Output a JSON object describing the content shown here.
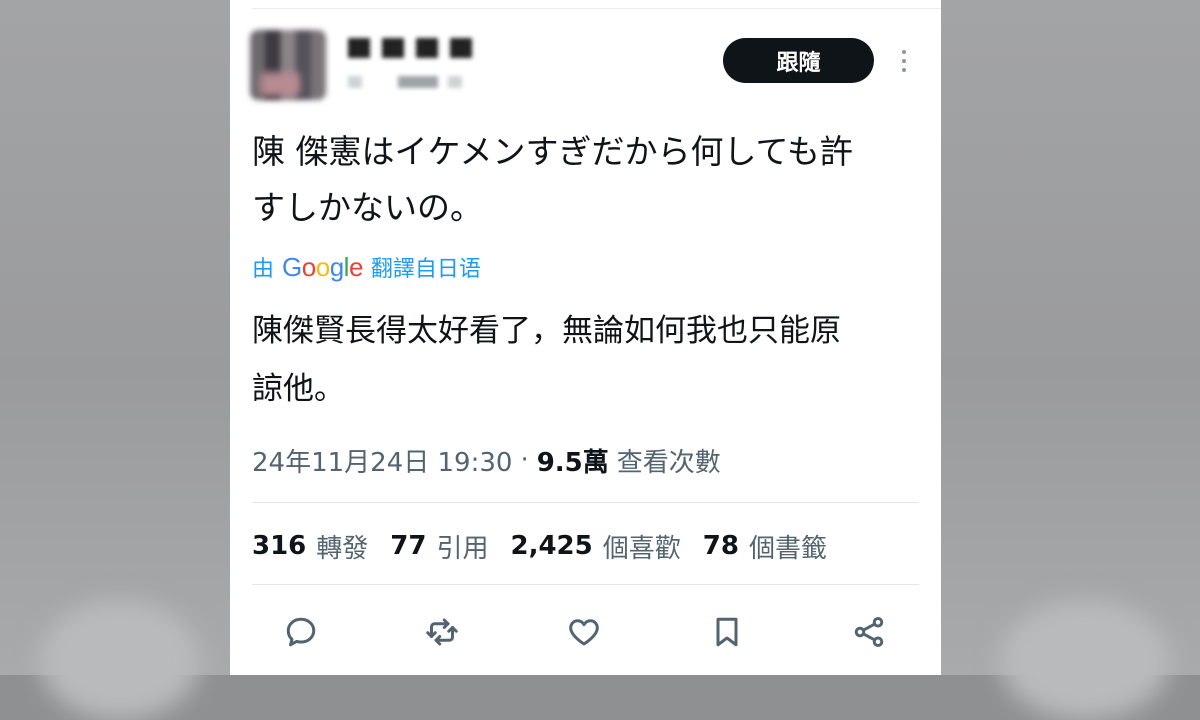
{
  "header": {
    "follow_label": "跟隨",
    "more_icon": "more-vertical-icon"
  },
  "tweet": {
    "text_line1": "陳 傑憲はイケメンすぎだから何しても許",
    "text_line2": "すしかないの。",
    "translated_by_prefix": "由",
    "translated_by_brand": "Google",
    "translated_by_suffix": "翻譯自日语",
    "translation_line1": "陳傑賢長得太好看了，無論如何我也只能原",
    "translation_line2": "諒他。",
    "timestamp": "24年11月24日 19:30",
    "separator": "·",
    "views_count": "9.5萬",
    "views_label": "查看次數"
  },
  "stats": [
    {
      "count": "316",
      "label": "轉發"
    },
    {
      "count": "77",
      "label": "引用"
    },
    {
      "count": "2,425",
      "label": "個喜歡"
    },
    {
      "count": "78",
      "label": "個書籤"
    }
  ],
  "actions": [
    {
      "icon": "reply-icon"
    },
    {
      "icon": "retweet-icon"
    },
    {
      "icon": "like-icon"
    },
    {
      "icon": "bookmark-icon"
    },
    {
      "icon": "share-icon"
    }
  ],
  "colors": {
    "text": "#0f1419",
    "secondary": "#536471",
    "link": "#1d9bf0",
    "button": "#0f1419"
  }
}
